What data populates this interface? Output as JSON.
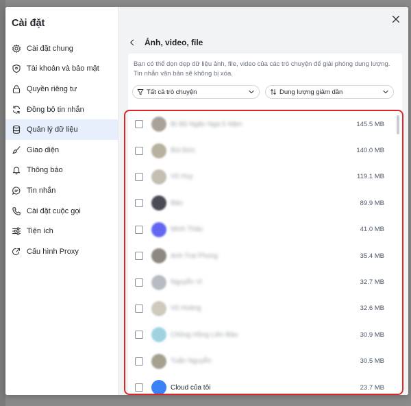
{
  "sidebar": {
    "title": "Cài đặt",
    "items": [
      {
        "label": "Cài đặt chung",
        "icon": "gear-icon"
      },
      {
        "label": "Tài khoản và bảo mật",
        "icon": "shield-icon"
      },
      {
        "label": "Quyền riêng tư",
        "icon": "lock-icon"
      },
      {
        "label": "Đồng bộ tin nhắn",
        "icon": "sync-icon"
      },
      {
        "label": "Quản lý dữ liệu",
        "icon": "database-icon",
        "active": true
      },
      {
        "label": "Giao diện",
        "icon": "brush-icon"
      },
      {
        "label": "Thông báo",
        "icon": "bell-icon"
      },
      {
        "label": "Tin nhắn",
        "icon": "chat-icon"
      },
      {
        "label": "Cài đặt cuộc gọi",
        "icon": "phone-icon"
      },
      {
        "label": "Tiện ích",
        "icon": "tools-icon"
      },
      {
        "label": "Cấu hình Proxy",
        "icon": "proxy-icon"
      }
    ]
  },
  "main": {
    "title": "Ảnh, video, file",
    "description": "Bạn có thể dọn dẹp dữ liệu ảnh, file, video của các trò chuyện để giải phóng dung lượng. Tin nhắn văn bản sẽ không bị xóa.",
    "filter_conversations": "Tất cả trò chuyện",
    "filter_sort": "Dung lượng giảm dần",
    "rows": [
      {
        "name": "Bí Bộ Ngân Ngà 5 Năm",
        "size": "145.5 MB",
        "avatar_color": "#a8a29a"
      },
      {
        "name": "Bùi Đức",
        "size": "140.0 MB",
        "avatar_color": "#b9b19f"
      },
      {
        "name": "Vũ Huy",
        "size": "119.1 MB",
        "avatar_color": "#c4beb2"
      },
      {
        "name": "Bảo",
        "size": "89.9 MB",
        "avatar_color": "#4a4a55"
      },
      {
        "name": "Minh Thảo",
        "size": "41.0 MB",
        "avatar_color": "#6366f1"
      },
      {
        "name": "Anh Trai Phong",
        "size": "35.4 MB",
        "avatar_color": "#8c8780"
      },
      {
        "name": "Nguyễn Vi",
        "size": "32.7 MB",
        "avatar_color": "#b7bcc4"
      },
      {
        "name": "Vũ Hoàng",
        "size": "32.6 MB",
        "avatar_color": "#cfc9bd"
      },
      {
        "name": "Chồng Hồng Liên Bảo",
        "size": "30.9 MB",
        "avatar_color": "#9fd3e0"
      },
      {
        "name": "Tuấn Nguyễn",
        "size": "30.5 MB",
        "avatar_color": "#a59f8e"
      },
      {
        "name": "Cloud của tôi",
        "size": "23.7 MB",
        "avatar_color": "#3b82f6",
        "clear": true
      }
    ]
  }
}
